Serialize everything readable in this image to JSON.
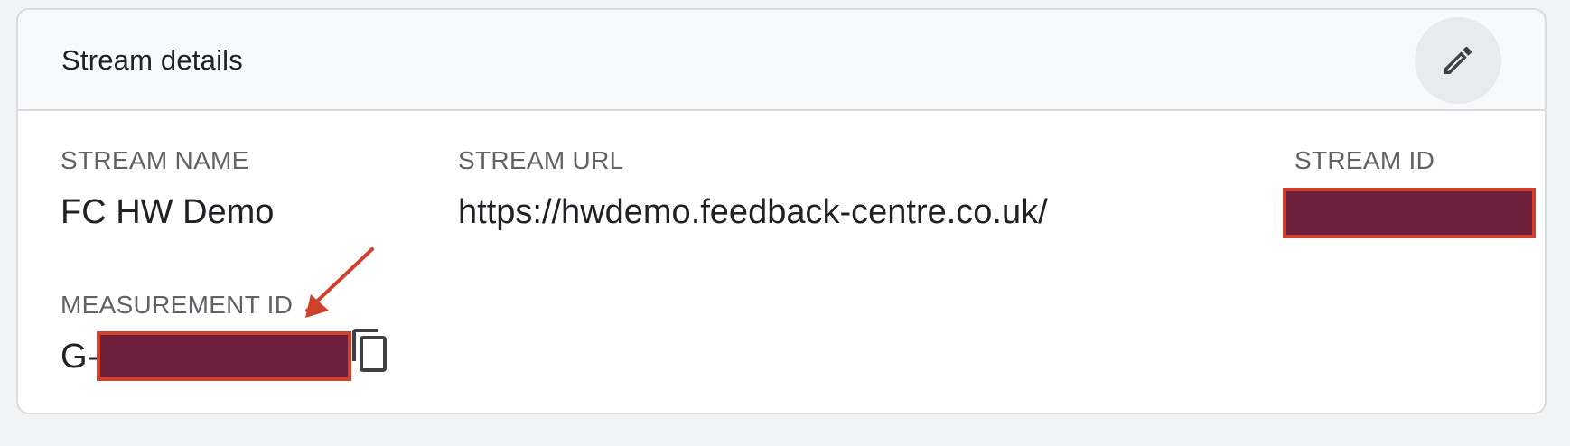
{
  "card": {
    "title": "Stream details",
    "edit_icon": "pencil-icon"
  },
  "stream_name": {
    "label": "STREAM NAME",
    "value": "FC HW Demo"
  },
  "stream_url": {
    "label": "STREAM URL",
    "value": "https://hwdemo.feedback-centre.co.uk/"
  },
  "stream_id": {
    "label": "STREAM ID"
  },
  "measurement_id": {
    "label": "MEASUREMENT ID",
    "prefix": "G-",
    "copy_icon": "copy-icon"
  },
  "colors": {
    "redaction_fill": "#6e1f3c",
    "redaction_border": "#d0402a",
    "arrow": "#d0402a"
  }
}
